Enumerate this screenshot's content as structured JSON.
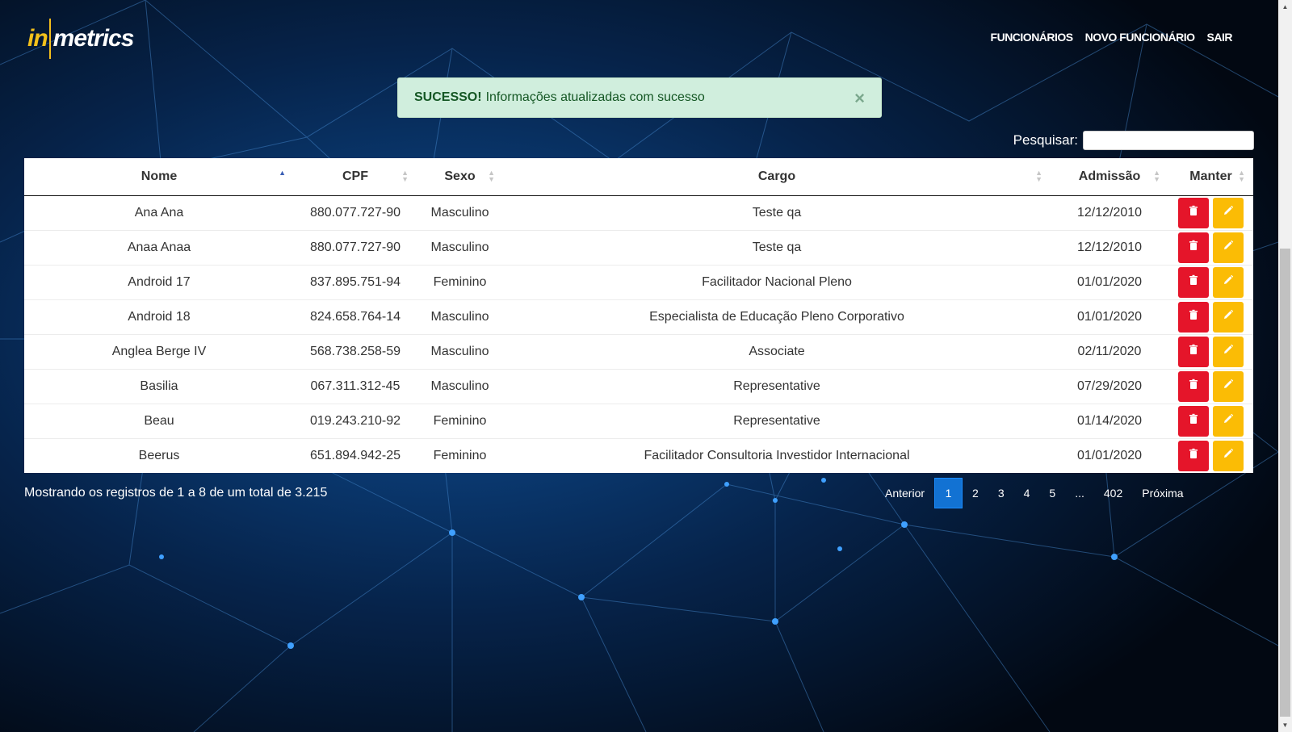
{
  "brand": {
    "logo_in": "in",
    "logo_metrics": "metrics"
  },
  "nav": {
    "funcionarios": "FUNCIONÁRIOS",
    "novo": "NOVO FUNCIONÁRIO",
    "sair": "SAIR"
  },
  "alert": {
    "title": "SUCESSO!",
    "message": "Informações atualizadas com sucesso",
    "close": "×"
  },
  "search": {
    "label": "Pesquisar:",
    "value": ""
  },
  "table": {
    "headers": {
      "nome": "Nome",
      "cpf": "CPF",
      "sexo": "Sexo",
      "cargo": "Cargo",
      "admissao": "Admissão",
      "manter": "Manter"
    },
    "rows": [
      {
        "nome": "Ana Ana",
        "cpf": "880.077.727-90",
        "sexo": "Masculino",
        "cargo": "Teste qa",
        "admissao": "12/12/2010"
      },
      {
        "nome": "Anaa Anaa",
        "cpf": "880.077.727-90",
        "sexo": "Masculino",
        "cargo": "Teste qa",
        "admissao": "12/12/2010"
      },
      {
        "nome": "Android 17",
        "cpf": "837.895.751-94",
        "sexo": "Feminino",
        "cargo": "Facilitador Nacional Pleno",
        "admissao": "01/01/2020"
      },
      {
        "nome": "Android 18",
        "cpf": "824.658.764-14",
        "sexo": "Masculino",
        "cargo": "Especialista de Educação Pleno Corporativo",
        "admissao": "01/01/2020"
      },
      {
        "nome": "Anglea Berge IV",
        "cpf": "568.738.258-59",
        "sexo": "Masculino",
        "cargo": "Associate",
        "admissao": "02/11/2020"
      },
      {
        "nome": "Basilia",
        "cpf": "067.311.312-45",
        "sexo": "Masculino",
        "cargo": "Representative",
        "admissao": "07/29/2020"
      },
      {
        "nome": "Beau",
        "cpf": "019.243.210-92",
        "sexo": "Feminino",
        "cargo": "Representative",
        "admissao": "01/14/2020"
      },
      {
        "nome": "Beerus",
        "cpf": "651.894.942-25",
        "sexo": "Feminino",
        "cargo": "Facilitador Consultoria Investidor Internacional",
        "admissao": "01/01/2020"
      }
    ]
  },
  "footer": {
    "info": "Mostrando os registros de 1 a 8 de um total de 3.215"
  },
  "pagination": {
    "prev": "Anterior",
    "p1": "1",
    "p2": "2",
    "p3": "3",
    "p4": "4",
    "p5": "5",
    "ellipsis": "...",
    "last": "402",
    "next": "Próxima"
  },
  "colors": {
    "brand_yellow": "#f2c01b",
    "delete_red": "#e5152a",
    "edit_yellow": "#fbbc05",
    "active_page": "#1272d3",
    "alert_green": "#d0eedd"
  },
  "icons": {
    "delete": "trash-icon",
    "edit": "pencil-icon"
  }
}
